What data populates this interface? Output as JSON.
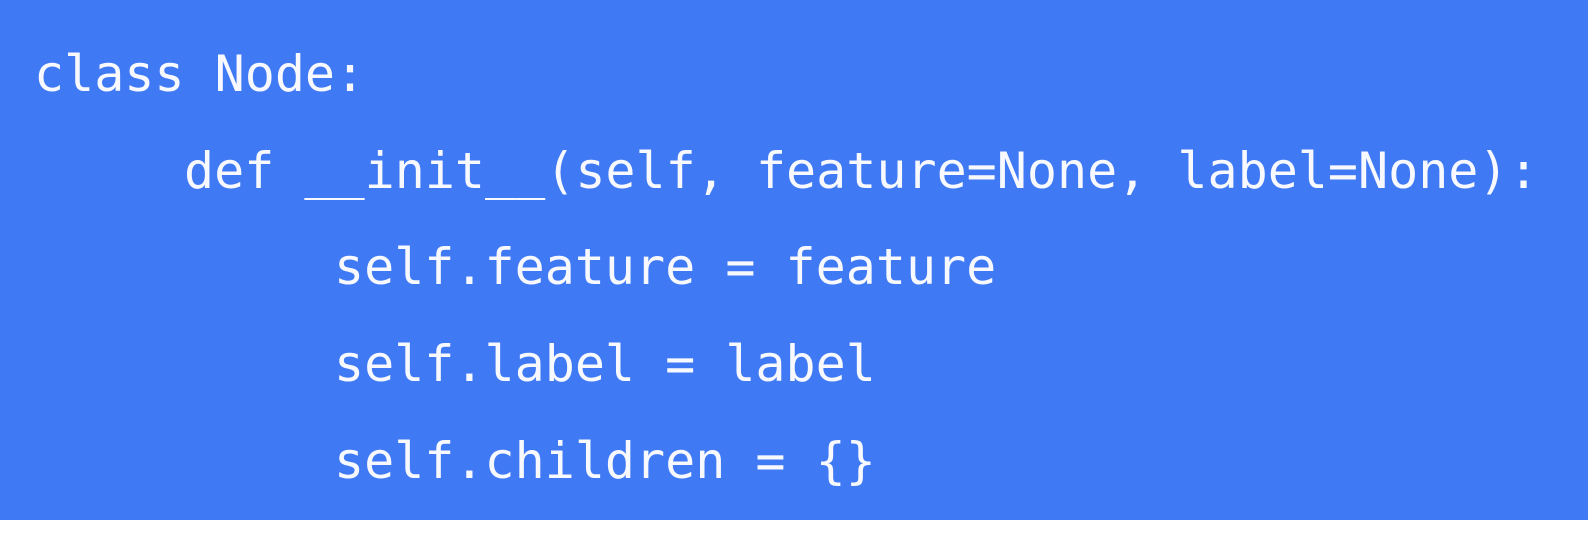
{
  "code": {
    "lines": [
      {
        "indent": 0,
        "text": "class Node:"
      },
      {
        "indent": 1,
        "text": "def __init__(self, feature=None, label=None):"
      },
      {
        "indent": 2,
        "text": "self.feature = feature"
      },
      {
        "indent": 2,
        "text": "self.label = label"
      },
      {
        "indent": 2,
        "text": "self.children = {}"
      }
    ]
  },
  "colors": {
    "background": "#4079f4",
    "text": "#f7f9ff"
  }
}
